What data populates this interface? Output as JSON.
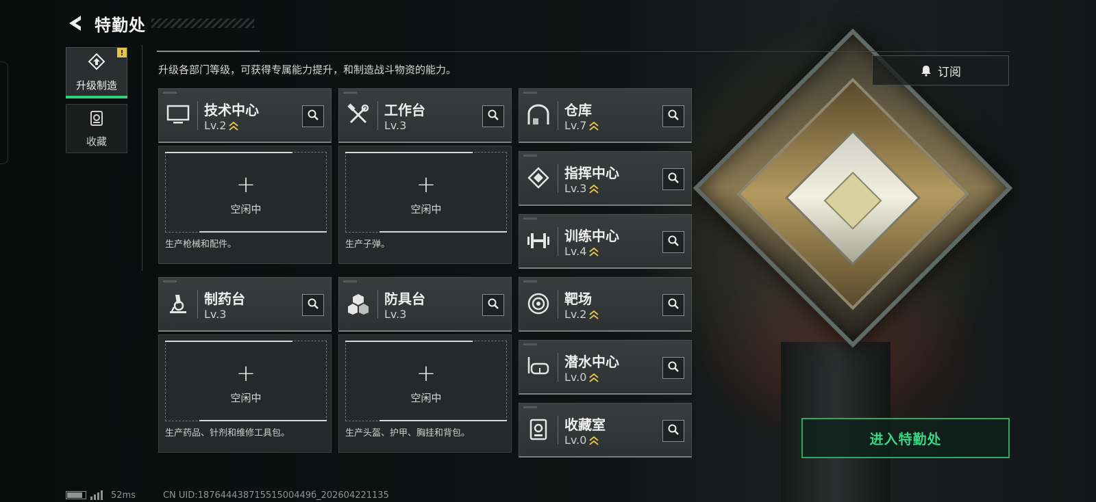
{
  "header": {
    "title": "特勤处"
  },
  "side_nav": {
    "items": [
      {
        "label": "升级制造",
        "badge": "!"
      },
      {
        "label": "收藏"
      }
    ]
  },
  "description": "升级各部门等级，可获得专属能力提升，和制造战斗物资的能力。",
  "subscribe_label": "订阅",
  "facilities": {
    "tech": {
      "name": "技术中心",
      "level": "Lv.2",
      "upgradable": true,
      "icon": "monitor-icon"
    },
    "workbench": {
      "name": "工作台",
      "level": "Lv.3",
      "upgradable": false,
      "icon": "hammer-wrench-icon"
    },
    "warehouse": {
      "name": "仓库",
      "level": "Lv.7",
      "upgradable": true,
      "icon": "garage-icon"
    },
    "command": {
      "name": "指挥中心",
      "level": "Lv.3",
      "upgradable": true,
      "icon": "chip-icon"
    },
    "training": {
      "name": "训练中心",
      "level": "Lv.4",
      "upgradable": true,
      "icon": "dumbbell-icon"
    },
    "pharmacy": {
      "name": "制药台",
      "level": "Lv.3",
      "upgradable": false,
      "icon": "microscope-icon"
    },
    "armor": {
      "name": "防具台",
      "level": "Lv.3",
      "upgradable": false,
      "icon": "cubes-icon"
    },
    "range": {
      "name": "靶场",
      "level": "Lv.2",
      "upgradable": true,
      "icon": "target-icon"
    },
    "diving": {
      "name": "潜水中心",
      "level": "Lv.0",
      "upgradable": true,
      "icon": "diving-mask-icon"
    },
    "collection": {
      "name": "收藏室",
      "level": "Lv.0",
      "upgradable": true,
      "icon": "trophy-icon"
    }
  },
  "production": {
    "tech": {
      "plus": "+",
      "status": "空闲中",
      "desc": "生产枪械和配件。"
    },
    "workbench": {
      "plus": "+",
      "status": "空闲中",
      "desc": "生产子弹。"
    },
    "pharmacy": {
      "plus": "+",
      "status": "空闲中",
      "desc": "生产药品、针剂和维修工具包。"
    },
    "armor": {
      "plus": "+",
      "status": "空闲中",
      "desc": "生产头盔、护甲、胸挂和背包。"
    }
  },
  "enter_button": "进入特勤处",
  "status_bar": {
    "ping": "52ms",
    "uid": "CN UID:18764443871551500449б_202604221135"
  },
  "colors": {
    "accent_green": "#39d583",
    "upgrade_gold": "#e5c24a"
  }
}
